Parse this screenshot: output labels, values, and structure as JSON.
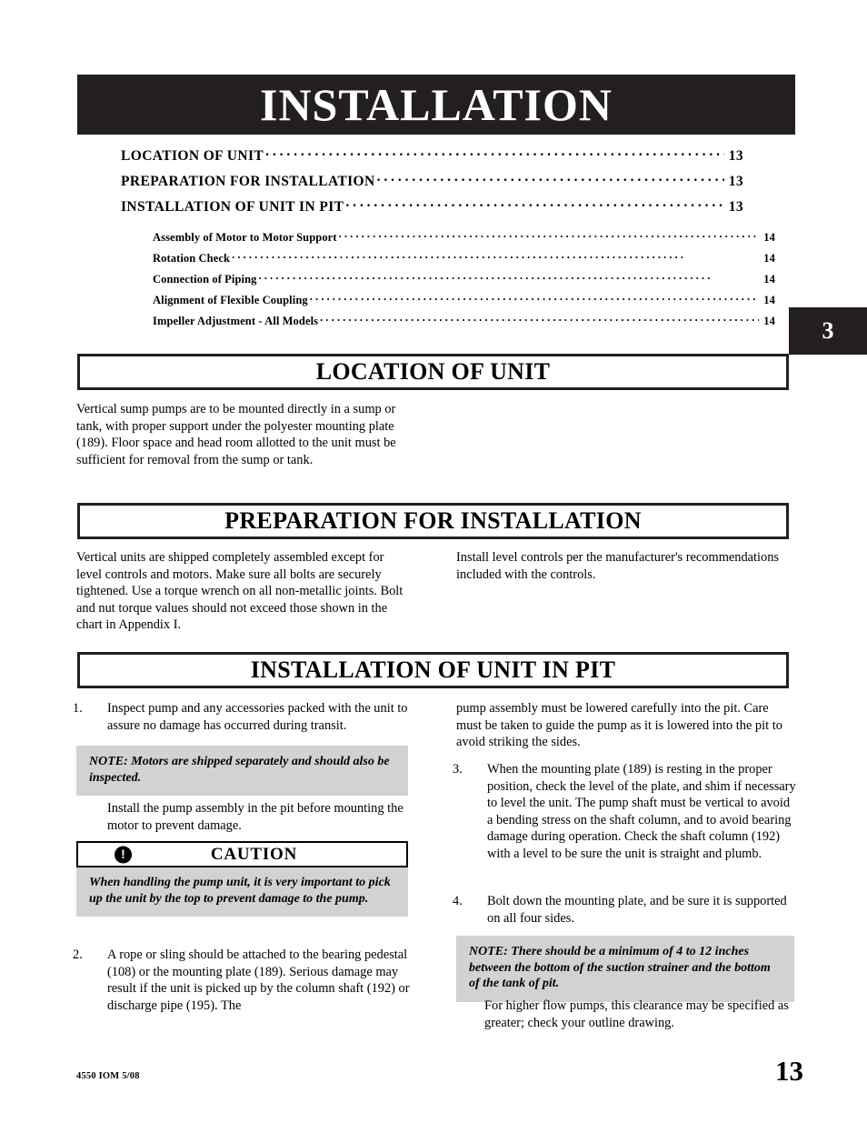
{
  "chapter": {
    "title": "INSTALLATION",
    "number": "3"
  },
  "toc": {
    "entries": [
      {
        "label": "LOCATION OF UNIT",
        "page": "13",
        "level": 1
      },
      {
        "label": "PREPARATION FOR INSTALLATION",
        "page": "13",
        "level": 1
      },
      {
        "label": "INSTALLATION OF UNIT IN PIT",
        "page": "13",
        "level": 1
      },
      {
        "label": "Assembly of Motor to Motor Support",
        "page": "14",
        "level": 2
      },
      {
        "label": "Rotation Check",
        "page": "14",
        "level": 2
      },
      {
        "label": "Connection of Piping",
        "page": "14",
        "level": 2
      },
      {
        "label": "Alignment of Flexible Coupling",
        "page": "14",
        "level": 2
      },
      {
        "label": "Impeller Adjustment - All Models",
        "page": "14",
        "level": 2
      }
    ]
  },
  "sections": {
    "location": {
      "heading": "LOCATION OF UNIT",
      "body": "Vertical sump pumps are to be mounted directly in a sump or tank, with proper support under the polyester mounting plate (189). Floor space and head room allotted to the unit must be sufficient for removal from the sump or tank."
    },
    "preparation": {
      "heading": "PREPARATION FOR INSTALLATION",
      "left_body": "Vertical units are shipped completely assembled except for level controls and motors. Make sure all bolts are securely tightened. Use a torque wrench on all non-metallic joints. Bolt and nut torque values should not exceed those shown in the chart in Appendix I.",
      "right_body": "Install level controls per the manufacturer's recommendations included with the controls."
    },
    "installation_in_pit": {
      "heading": "INSTALLATION OF UNIT IN PIT",
      "item1": {
        "number": "1.",
        "text": "Inspect pump and any accessories packed with the unit to assure no damage has occurred during transit."
      },
      "note_motors": "NOTE: Motors are shipped separately and should also be inspected.",
      "install_before_motor": "Install the pump assembly in the pit before mounting the motor to prevent damage.",
      "caution": {
        "title": "CAUTION",
        "icon": "exclamation-circle-icon",
        "text": "When handling the pump unit, it is very important to pick up the unit by the top to prevent damage to the pump."
      },
      "item2": {
        "number": "2.",
        "text": "A rope or sling should be attached to the bearing pedestal (108) or the mounting plate (189). Serious damage may result if the unit is picked up by the column shaft  (192) or discharge pipe (195). The"
      },
      "item2_continued": "pump assembly must be lowered carefully into the pit. Care must be taken to guide the pump as it is lowered into the pit to avoid striking the sides.",
      "item3": {
        "number": "3.",
        "text": "When the mounting plate (189) is resting in the proper position, check the level of the plate, and shim if necessary to level the unit. The pump shaft must be vertical to avoid a bending stress on the shaft column, and to avoid bearing damage during operation. Check the shaft column (192) with a level to be sure the unit is straight and plumb."
      },
      "item4": {
        "number": "4.",
        "text": "Bolt down the mounting plate, and be sure it is supported on all four sides."
      },
      "note_clearance": "NOTE: There should be a minimum of 4 to 12 inches between the bottom of the suction strainer and the bottom of the tank of pit.",
      "higher_flow": "For higher flow pumps, this clearance may be specified as greater; check your outline drawing."
    }
  },
  "footer": {
    "document_id": "4550 IOM 5/08",
    "page_number": "13"
  },
  "colors": {
    "banner_black": "#231f20",
    "note_gray": "#d2d2d2",
    "paper_white": "#ffffff"
  }
}
